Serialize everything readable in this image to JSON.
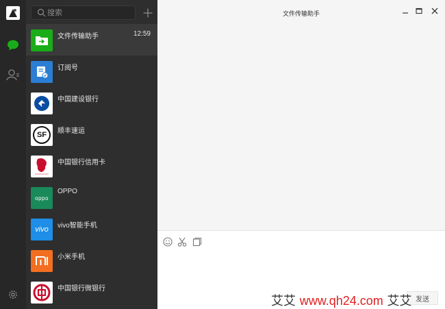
{
  "window": {
    "title": "文件传输助手"
  },
  "search": {
    "placeholder": "搜索"
  },
  "chats": [
    {
      "name": "文件传输助手",
      "time": "12:59"
    },
    {
      "name": "订阅号",
      "time": ""
    },
    {
      "name": "中国建设银行",
      "time": ""
    },
    {
      "name": "顺丰速运",
      "time": ""
    },
    {
      "name": "中国银行信用卡",
      "time": ""
    },
    {
      "name": "OPPO",
      "time": ""
    },
    {
      "name": "vivo智能手机",
      "time": ""
    },
    {
      "name": "小米手机",
      "time": ""
    },
    {
      "name": "中国银行微银行",
      "time": ""
    }
  ],
  "avatar_text": {
    "sf": "SF",
    "oppo": "oppo",
    "vivo": "vivo"
  },
  "composer": {
    "send_label": "发送"
  },
  "watermark": {
    "left": "艾艾",
    "url": "www.qh24.com",
    "right": "艾艾"
  },
  "colors": {
    "nav_bg": "#272727",
    "list_bg": "#2e2e2e",
    "active_bg": "#3a3a3a",
    "accent_green": "#1aad19",
    "main_bg": "#f5f5f5"
  }
}
